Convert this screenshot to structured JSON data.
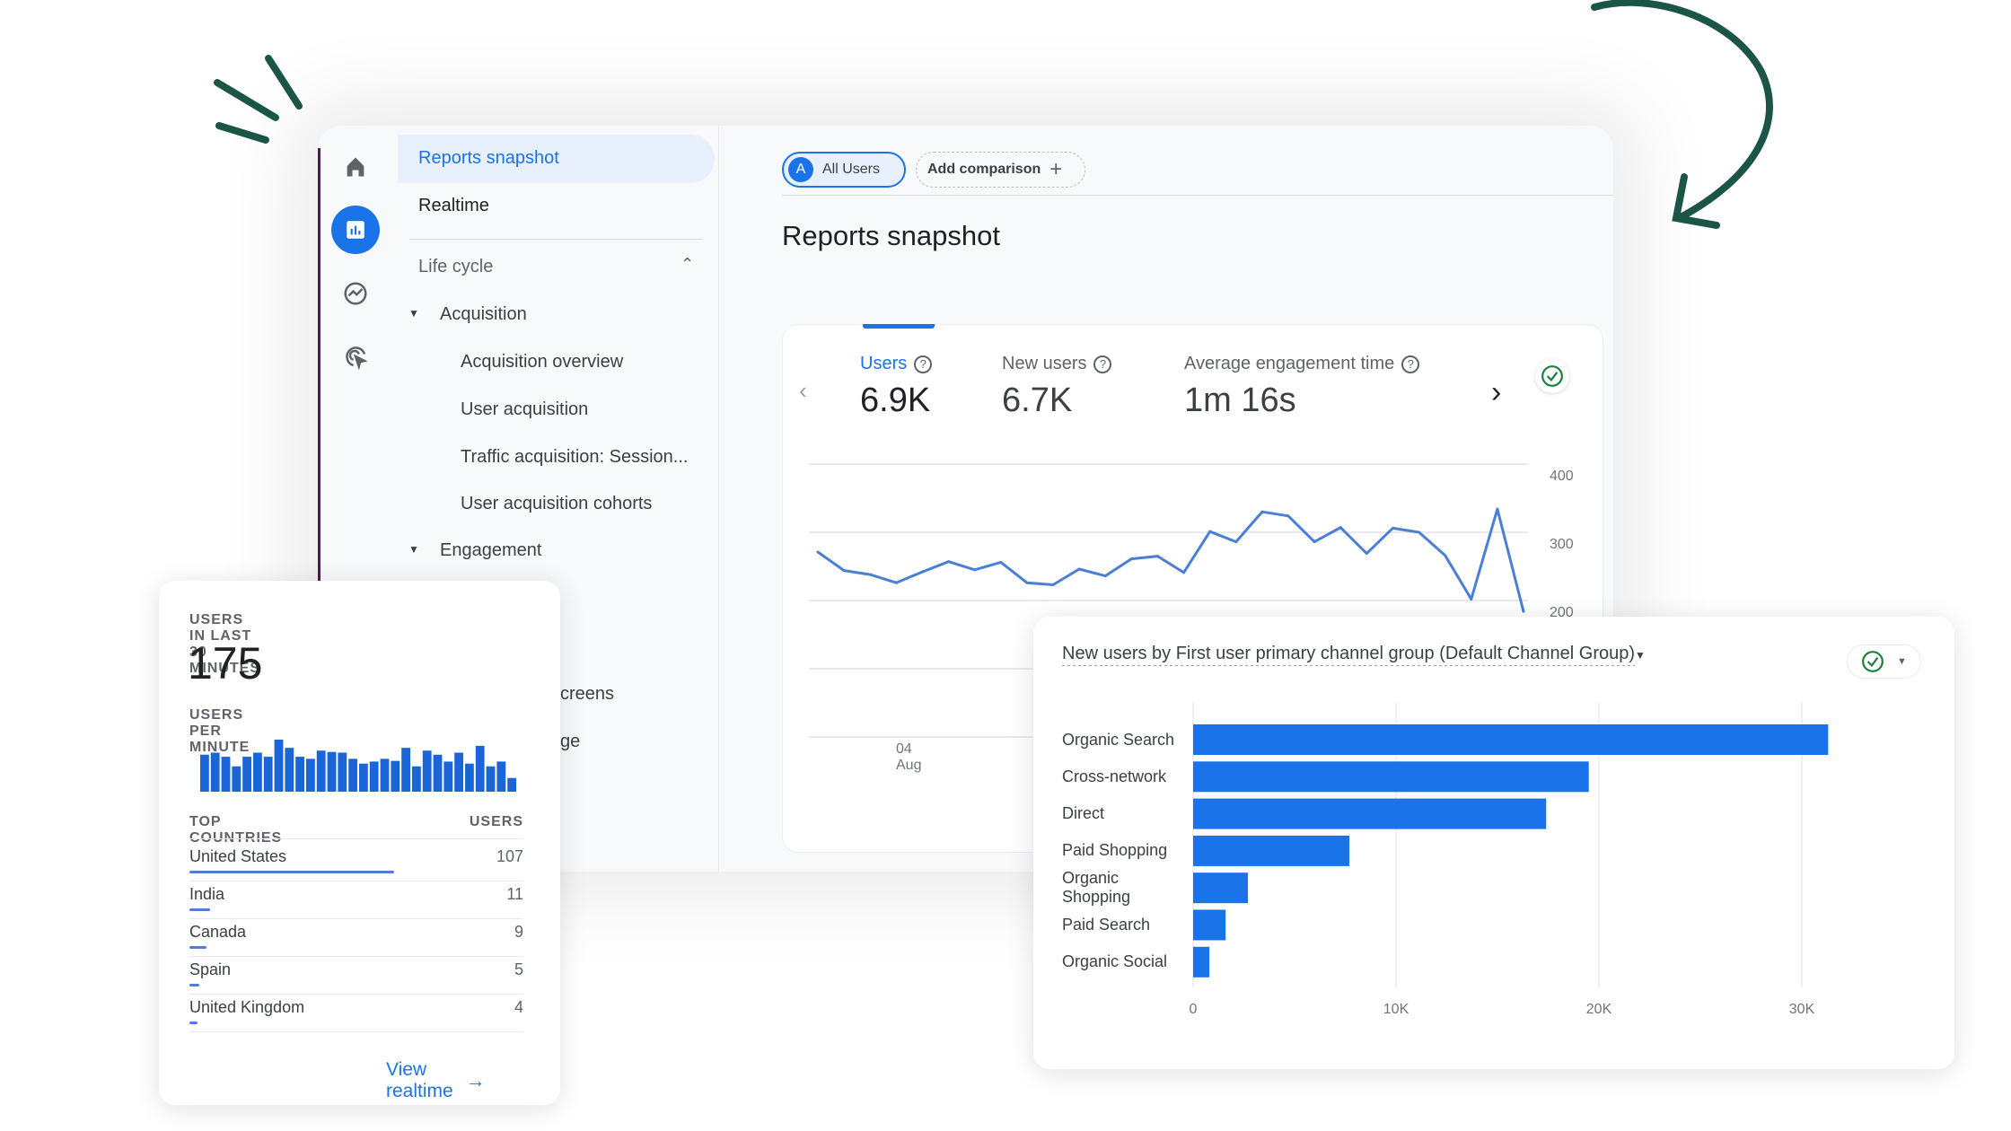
{
  "colors": {
    "accent": "#1a73e8",
    "deco": "#1b5546",
    "success": "#188038",
    "sidebar_border": "#4a1d4f"
  },
  "rail": {
    "icons": [
      "home-icon",
      "reports-icon",
      "explore-icon",
      "advertising-icon"
    ]
  },
  "nav": {
    "items": [
      {
        "label": "Reports snapshot",
        "active": true
      },
      {
        "label": "Realtime"
      }
    ],
    "section": {
      "label": "Life cycle",
      "expanded": true
    },
    "groups": [
      {
        "label": "Acquisition",
        "children": [
          "Acquisition overview",
          "User acquisition",
          "Traffic acquisition: Session...",
          "User acquisition cohorts"
        ]
      },
      {
        "label": "Engagement",
        "visible_fragments": [
          "creens",
          "ge"
        ]
      }
    ]
  },
  "toolbar": {
    "segment_letter": "A",
    "segment": "All Users",
    "add_comparison": "Add comparison"
  },
  "page_title": "Reports snapshot",
  "metrics": [
    {
      "label": "Users",
      "value": "6.9K",
      "selected": true
    },
    {
      "label": "New users",
      "value": "6.7K"
    },
    {
      "label": "Average engagement time",
      "value": "1m 16s"
    }
  ],
  "chart_data": [
    {
      "type": "line",
      "y_ticks": [
        "400",
        "300",
        "200"
      ],
      "ylim": [
        0,
        400
      ],
      "x_tick": {
        "day": "04",
        "month": "Aug"
      },
      "grid": true,
      "series": [
        {
          "values": [
            271,
            244,
            238,
            226,
            242,
            257,
            245,
            256,
            226,
            223,
            246,
            236,
            261,
            265,
            241,
            301,
            286,
            330,
            324,
            286,
            307,
            269,
            306,
            300,
            266,
            202,
            334,
            184
          ]
        }
      ]
    },
    {
      "type": "bar",
      "orientation": "horizontal",
      "title": "New users by First user primary channel group (Default Channel Group)",
      "categories": [
        "Organic Search",
        "Cross-network",
        "Direct",
        "Paid Shopping",
        "Organic Shopping",
        "Paid Search",
        "Organic Social"
      ],
      "values": [
        31300,
        19500,
        17400,
        7700,
        2700,
        1600,
        800
      ],
      "xlim": [
        0,
        35000
      ],
      "x_ticks": [
        "0",
        "10K",
        "20K",
        "30K"
      ],
      "grid": true
    },
    {
      "type": "bar",
      "title": "USERS PER MINUTE",
      "values": [
        108,
        114,
        102,
        74,
        102,
        114,
        102,
        152,
        128,
        102,
        96,
        120,
        116,
        114,
        96,
        82,
        88,
        96,
        90,
        128,
        74,
        120,
        108,
        88,
        114,
        82,
        134,
        74,
        88,
        40
      ]
    }
  ],
  "realtime": {
    "title": "USERS IN LAST 30 MINUTES",
    "count": "175",
    "per_minute_label": "USERS PER MINUTE",
    "col_country": "TOP COUNTRIES",
    "col_users": "USERS",
    "rows": [
      {
        "country": "United States",
        "users": "107"
      },
      {
        "country": "India",
        "users": "11"
      },
      {
        "country": "Canada",
        "users": "9"
      },
      {
        "country": "Spain",
        "users": "5"
      },
      {
        "country": "United Kingdom",
        "users": "4"
      }
    ],
    "link": "View realtime"
  }
}
